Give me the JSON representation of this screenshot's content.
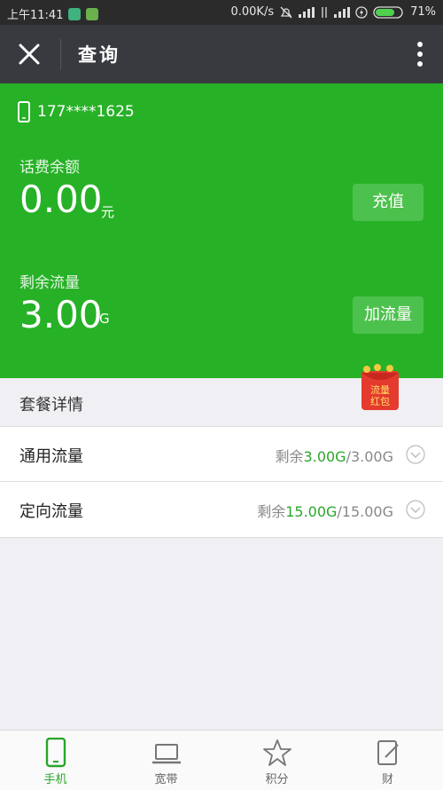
{
  "status_bar": {
    "time": "上午11:41",
    "network_speed": "0.00K/s",
    "battery": "71%"
  },
  "header": {
    "title": "查询"
  },
  "account": {
    "phone": "177****1625",
    "balance_label": "话费余额",
    "balance_value": "0.00",
    "balance_unit": "元",
    "recharge_button": "充值",
    "data_label": "剩余流量",
    "data_value": "3.00",
    "data_unit": "G",
    "add_data_button": "加流量"
  },
  "red_packet": {
    "line1": "流量",
    "line2": "红包"
  },
  "plan": {
    "section_title": "套餐详情",
    "items": [
      {
        "name": "通用流量",
        "prefix": "剩余",
        "remaining": "3.00G",
        "total": "/3.00G"
      },
      {
        "name": "定向流量",
        "prefix": "剩余",
        "remaining": "15.00G",
        "total": "/15.00G"
      }
    ]
  },
  "tabs": [
    {
      "label": "手机",
      "icon": "phone-icon",
      "active": true
    },
    {
      "label": "宽带",
      "icon": "laptop-icon",
      "active": false
    },
    {
      "label": "积分",
      "icon": "star-icon",
      "active": false
    },
    {
      "label": "财",
      "icon": "edit-icon",
      "active": false
    }
  ],
  "colors": {
    "primary_green": "#27b127",
    "header_dark": "#393a3f",
    "highlight_green": "#2aa62a"
  }
}
